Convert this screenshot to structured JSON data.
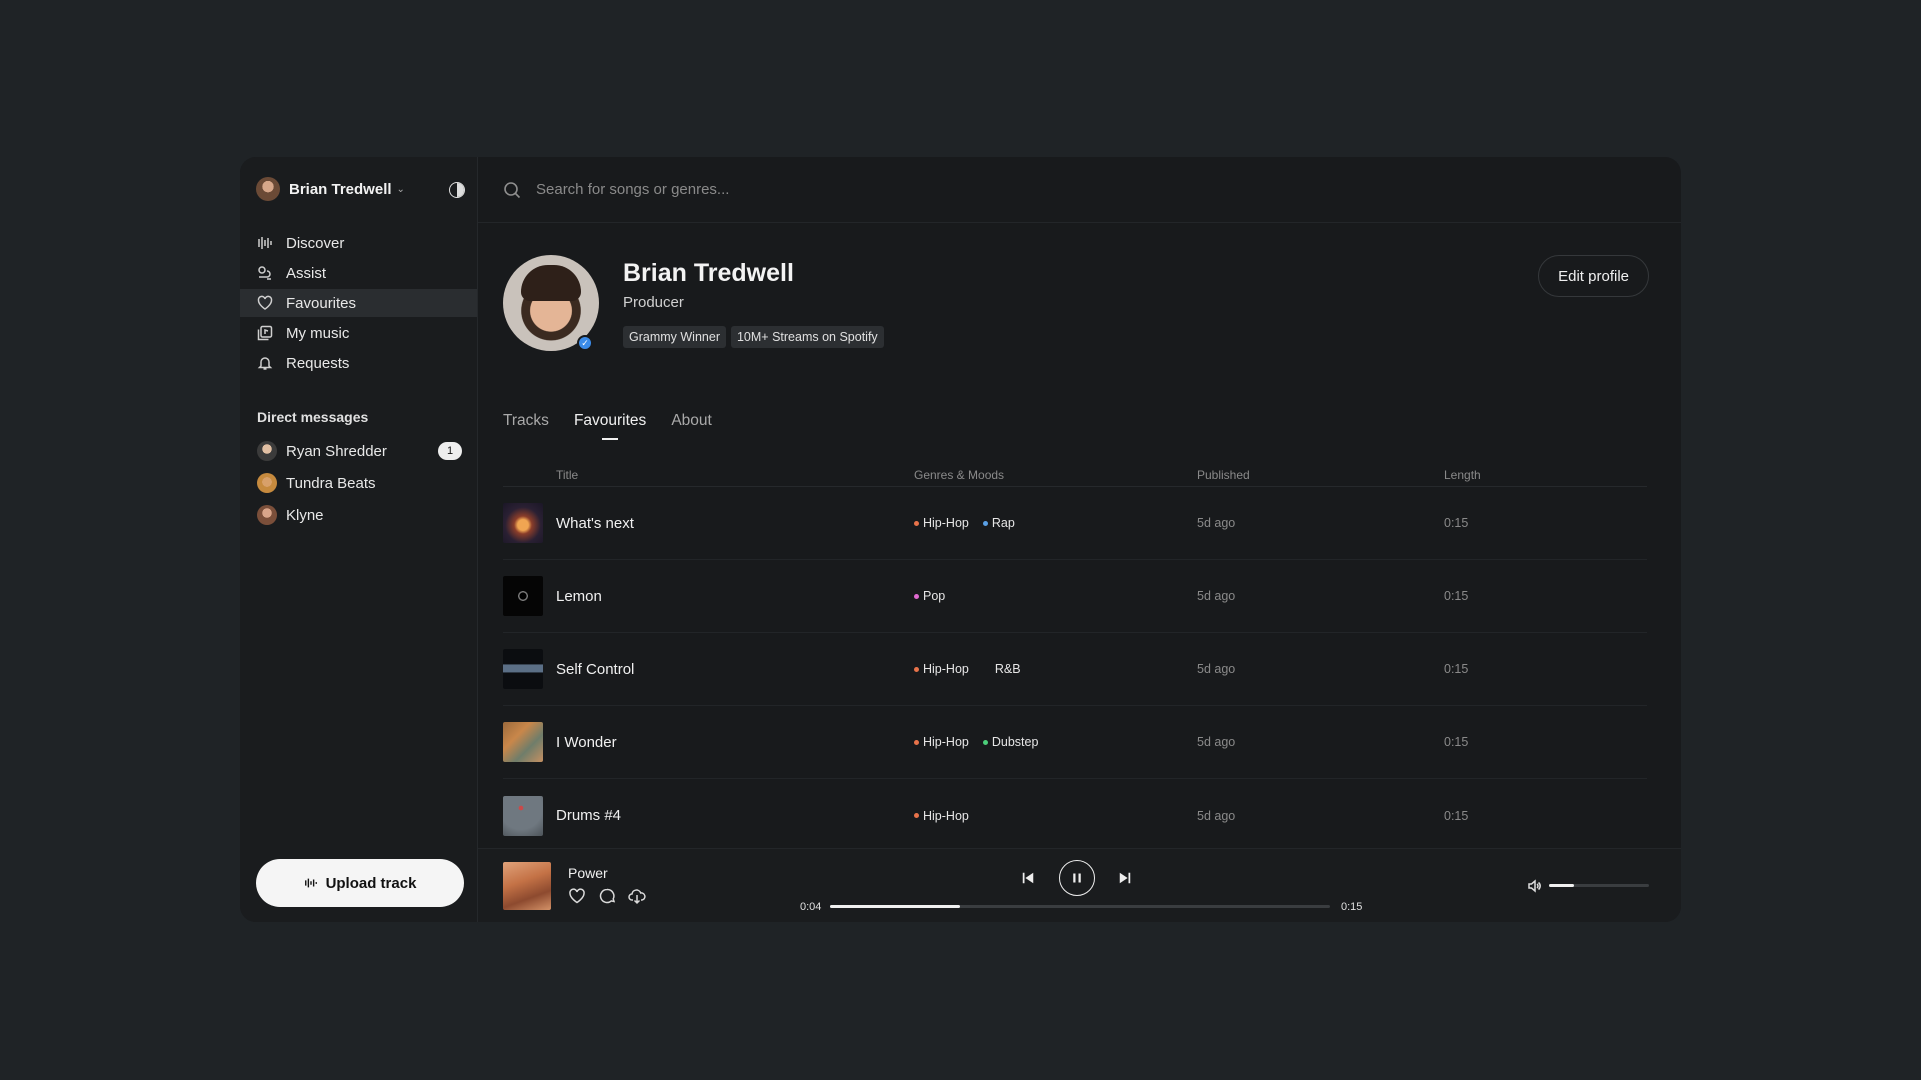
{
  "user": {
    "name": "Brian Tredwell"
  },
  "nav": [
    {
      "label": "Discover",
      "icon": "waveform-icon"
    },
    {
      "label": "Assist",
      "icon": "assist-icon"
    },
    {
      "label": "Favourites",
      "icon": "heart-icon",
      "active": true
    },
    {
      "label": "My music",
      "icon": "music-library-icon"
    },
    {
      "label": "Requests",
      "icon": "bell-icon"
    }
  ],
  "direct_messages": {
    "title": "Direct messages",
    "items": [
      {
        "name": "Ryan Shredder",
        "badge": "1"
      },
      {
        "name": "Tundra Beats"
      },
      {
        "name": "Klyne"
      }
    ]
  },
  "upload": {
    "label": "Upload track"
  },
  "search": {
    "placeholder": "Search for songs or genres..."
  },
  "profile": {
    "name": "Brian Tredwell",
    "role": "Producer",
    "tags": [
      "Grammy Winner",
      "10M+ Streams on Spotify"
    ],
    "edit_label": "Edit profile"
  },
  "tabs": [
    {
      "label": "Tracks"
    },
    {
      "label": "Favourites",
      "active": true
    },
    {
      "label": "About"
    }
  ],
  "table": {
    "headers": {
      "title": "Title",
      "genres": "Genres & Moods",
      "published": "Published",
      "length": "Length"
    },
    "rows": [
      {
        "title": "What's next",
        "genres": [
          {
            "name": "Hip-Hop",
            "color": "#e8734a"
          },
          {
            "name": "Rap",
            "color": "#5aa0e6"
          }
        ],
        "published": "5d ago",
        "length": "0:15"
      },
      {
        "title": "Lemon",
        "genres": [
          {
            "name": "Pop",
            "color": "#e06ad0"
          }
        ],
        "published": "5d ago",
        "length": "0:15"
      },
      {
        "title": "Self Control",
        "genres": [
          {
            "name": "Hip-Hop",
            "color": "#e8734a"
          },
          {
            "name": "R&B",
            "color": ""
          }
        ],
        "published": "5d ago",
        "length": "0:15"
      },
      {
        "title": "I Wonder",
        "genres": [
          {
            "name": "Hip-Hop",
            "color": "#e8734a"
          },
          {
            "name": "Dubstep",
            "color": "#4ccf7a"
          }
        ],
        "published": "5d ago",
        "length": "0:15"
      },
      {
        "title": "Drums #4",
        "genres": [
          {
            "name": "Hip-Hop",
            "color": "#e8734a"
          }
        ],
        "published": "5d ago",
        "length": "0:15"
      }
    ]
  },
  "player": {
    "title": "Power",
    "current_time": "0:04",
    "total_time": "0:15",
    "progress": 0.26,
    "volume": 0.25
  }
}
